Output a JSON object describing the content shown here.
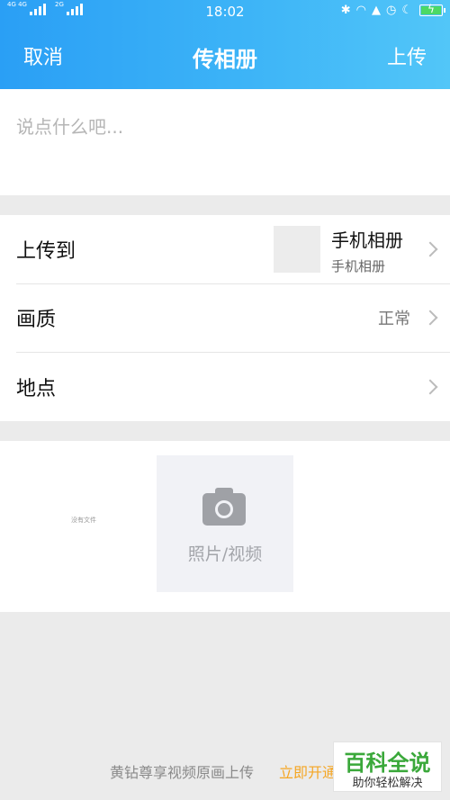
{
  "status_bar": {
    "network_1": "4G 4G",
    "network_2": "2G",
    "time": "18:02",
    "icons": [
      "bluetooth-icon",
      "headset-icon",
      "notification-icon",
      "alarm-icon",
      "moon-icon",
      "battery-charging-icon"
    ]
  },
  "nav": {
    "cancel_label": "取消",
    "title": "传相册",
    "upload_label": "上传"
  },
  "post": {
    "placeholder": "说点什么吧...",
    "value": ""
  },
  "settings": {
    "upload_to": {
      "label": "上传到",
      "album_name": "手机相册",
      "album_sub": "手机相册"
    },
    "quality": {
      "label": "画质",
      "value": "正常"
    },
    "location": {
      "label": "地点"
    }
  },
  "media": {
    "no_file_text": "没有文件",
    "add_label": "照片/视频",
    "add_icon": "camera-icon"
  },
  "promo": {
    "text": "黄钻尊享视频原画上传",
    "link": "立即开通"
  },
  "watermark": {
    "title": "百科全说",
    "subtitle": "助你轻松解决"
  },
  "colors": {
    "header_start": "#2a9ff5",
    "header_end": "#52c6f8",
    "promo_link": "#f5a623",
    "watermark_green": "#3aa83a"
  }
}
